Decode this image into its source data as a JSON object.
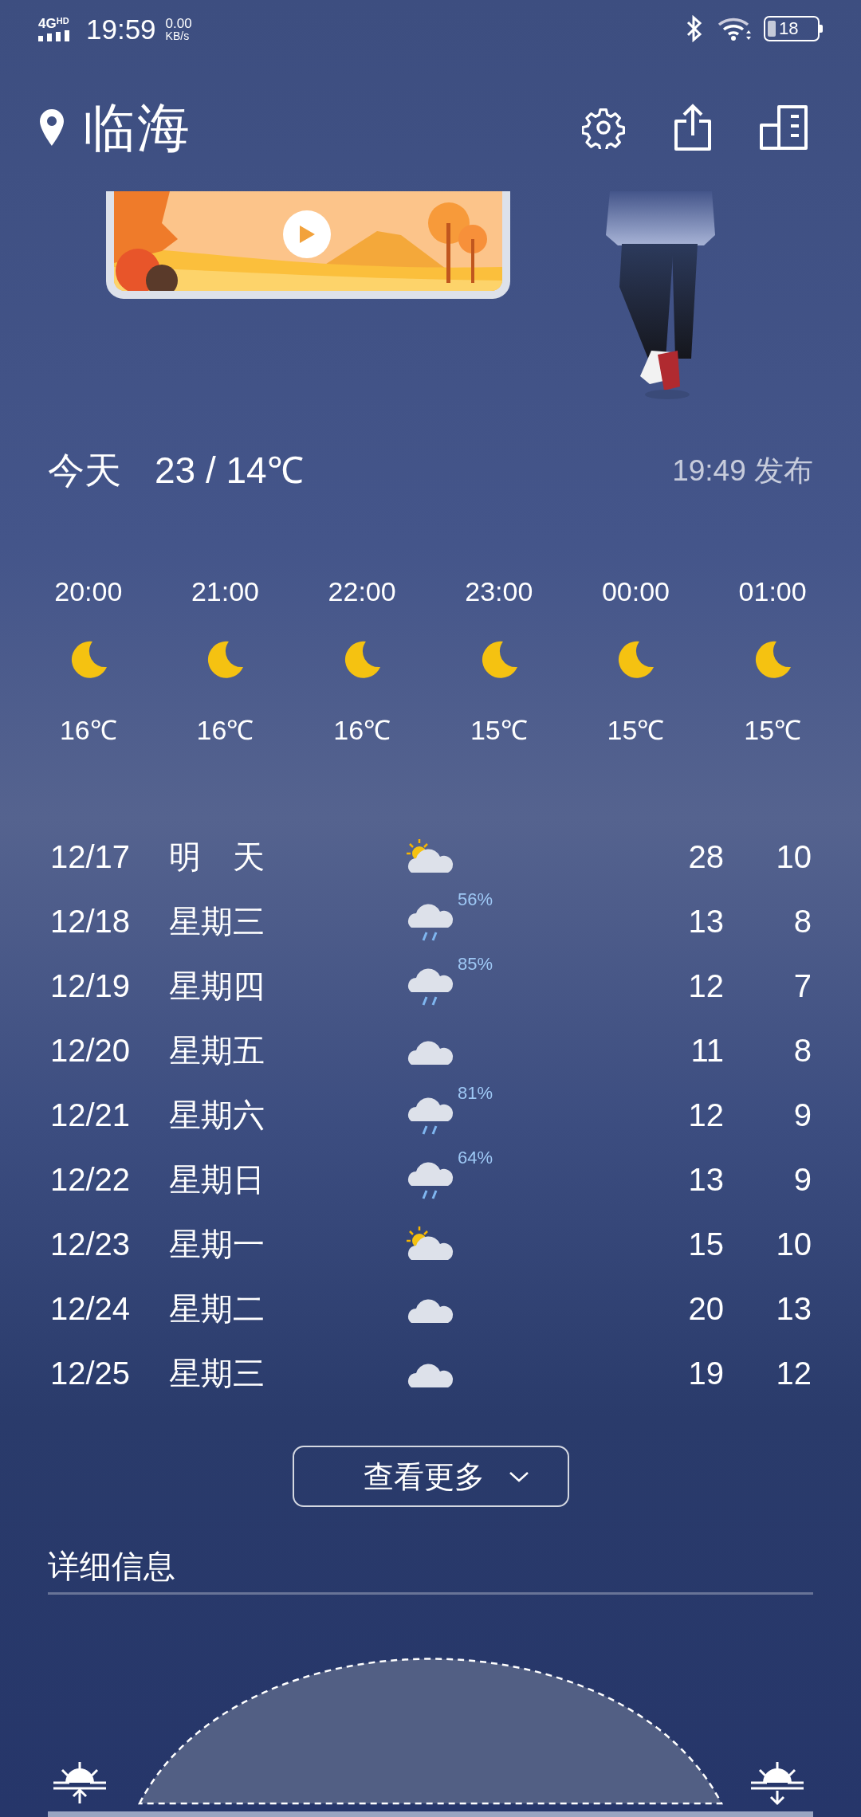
{
  "status_bar": {
    "network": "4G",
    "network_badge": "HD",
    "time": "19:59",
    "speed_value": "0.00",
    "speed_unit": "KB/s",
    "battery": "18"
  },
  "header": {
    "location": "临海"
  },
  "today": {
    "label": "今天",
    "range": "23 / 14℃",
    "published": "19:49 发布"
  },
  "hourly": [
    {
      "time": "20:00",
      "kind": "moon",
      "temp": "16℃"
    },
    {
      "time": "21:00",
      "kind": "moon",
      "temp": "16℃"
    },
    {
      "time": "22:00",
      "kind": "moon",
      "temp": "16℃"
    },
    {
      "time": "23:00",
      "kind": "moon",
      "temp": "15℃"
    },
    {
      "time": "00:00",
      "kind": "moon",
      "temp": "15℃"
    },
    {
      "time": "01:00",
      "kind": "moon",
      "temp": "15℃"
    }
  ],
  "daily": [
    {
      "date": "12/17",
      "day": "明　天",
      "kind": "partly_cloudy",
      "high": "28",
      "low": "10"
    },
    {
      "date": "12/18",
      "day": "星期三",
      "kind": "rain",
      "precip": "56%",
      "high": "13",
      "low": "8"
    },
    {
      "date": "12/19",
      "day": "星期四",
      "kind": "rain",
      "precip": "85%",
      "high": "12",
      "low": "7"
    },
    {
      "date": "12/20",
      "day": "星期五",
      "kind": "cloudy",
      "high": "11",
      "low": "8"
    },
    {
      "date": "12/21",
      "day": "星期六",
      "kind": "rain",
      "precip": "81%",
      "high": "12",
      "low": "9"
    },
    {
      "date": "12/22",
      "day": "星期日",
      "kind": "rain",
      "precip": "64%",
      "high": "13",
      "low": "9"
    },
    {
      "date": "12/23",
      "day": "星期一",
      "kind": "partly_cloudy",
      "high": "15",
      "low": "10"
    },
    {
      "date": "12/24",
      "day": "星期二",
      "kind": "cloudy",
      "high": "20",
      "low": "13"
    },
    {
      "date": "12/25",
      "day": "星期三",
      "kind": "cloudy",
      "high": "19",
      "low": "12"
    }
  ],
  "more_button": {
    "label": "查看更多"
  },
  "details": {
    "title": "详细信息"
  }
}
